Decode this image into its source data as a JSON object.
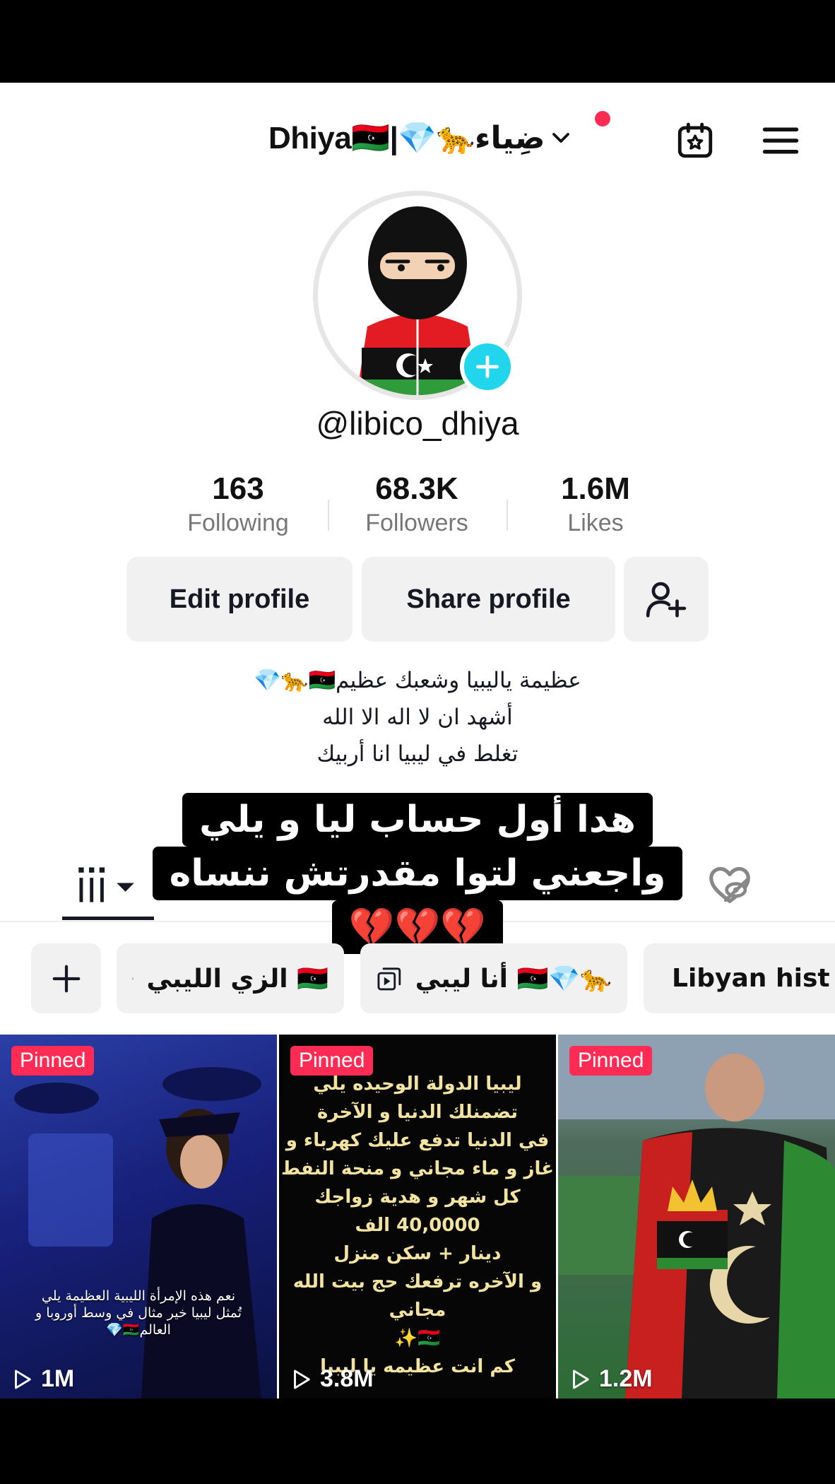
{
  "header": {
    "account_name": "Dhiya🇱🇾|💎🐆ضِياء",
    "calendar_icon": "calendar-star-icon",
    "menu_icon": "hamburger-menu-icon"
  },
  "profile": {
    "username": "@libico_dhiya",
    "stats": [
      {
        "value": "163",
        "label": "Following"
      },
      {
        "value": "68.3K",
        "label": "Followers"
      },
      {
        "value": "1.6M",
        "label": "Likes"
      }
    ],
    "buttons": {
      "edit": "Edit profile",
      "share": "Share profile"
    },
    "bio": [
      "عظيمة ياليبيا وشعبك عظيم🇱🇾🐆💎",
      "أشهد ان لا اله الا الله",
      "تغلط في ليبيا انا أربيك"
    ]
  },
  "caption_overlay": [
    "هدا أول حساب ليا و يلي",
    "واجعني لتوا مقدرتش ننساه",
    "💔💔💔"
  ],
  "playlists": [
    {
      "label": "الزي الليبي 🇱🇾"
    },
    {
      "label": "أنا ليبي 🇱🇾💎🐆"
    },
    {
      "label": "Libyan hist"
    }
  ],
  "videos": [
    {
      "badge": "Pinned",
      "views": "1M",
      "caption": "نعم هذه الإمرأة الليبية العظيمة يلي تُمثل ليبيا خير مثال في وسط أوروبا و العالم🇱🇾💎"
    },
    {
      "badge": "Pinned",
      "views": "3.8M",
      "lines": [
        "ليبيا الدولة الوحيده يلي",
        "تضمنلك الدنيا و الآخرة",
        "في الدنيا تدفع عليك كهرباء و",
        "غاز و ماء مجاني و منحة النفط",
        "كل شهر و هدية زواجك 40,0000 الف",
        "دينار + سكن منزل",
        "و الآخره ترفعك حج بيت الله",
        "مجاني",
        "🇱🇾✨",
        "كم انت عظيمه يا ليبيا"
      ]
    },
    {
      "badge": "Pinned",
      "views": "1.2M"
    }
  ],
  "colors": {
    "accent": "#fe2c55",
    "add_avatar": "#20d5ec",
    "button_bg": "#f1f1f2"
  }
}
